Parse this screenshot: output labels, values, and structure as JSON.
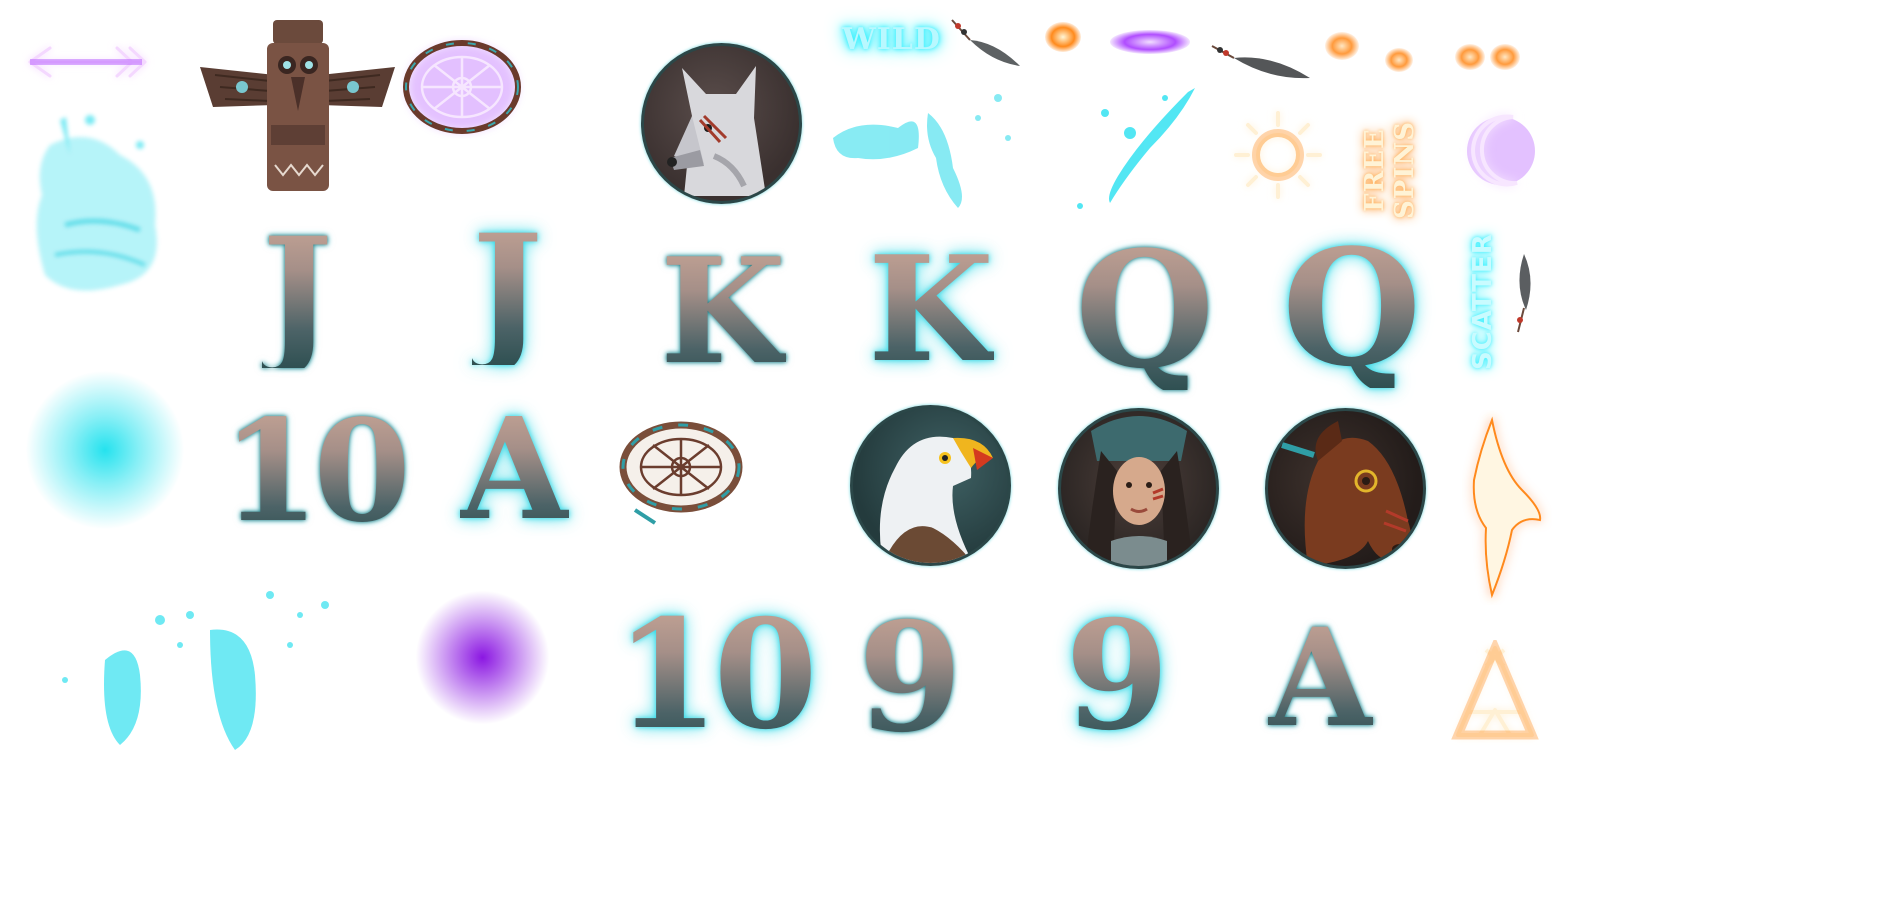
{
  "labels": {
    "wild": "WILD",
    "free_spins_line1": "FREE",
    "free_spins_line2": "SPINS",
    "scatter": "SCATTER"
  },
  "card_symbols": {
    "row1": [
      "J",
      "J",
      "K",
      "K",
      "Q",
      "Q"
    ],
    "row2": [
      "10",
      "A"
    ],
    "row3": [
      "10",
      "9",
      "9",
      "A"
    ]
  },
  "icons": [
    "neon-arrow-icon",
    "totem-pole-icon",
    "neon-dreamcatcher-icon",
    "wolf-portrait",
    "feather-icon",
    "neon-sun-icon",
    "neon-moon-icon",
    "dreamcatcher-icon",
    "eagle-portrait",
    "native-woman-portrait",
    "horse-portrait",
    "neon-eagle-icon",
    "neon-teepee-icon"
  ],
  "colors": {
    "neon_purple": "#b04dff",
    "neon_cyan": "#2ff0ff",
    "neon_orange": "#ff8a1c",
    "neon_cream": "#fff2c8",
    "card_dark": "#2f5052",
    "card_light": "#c7a596"
  }
}
